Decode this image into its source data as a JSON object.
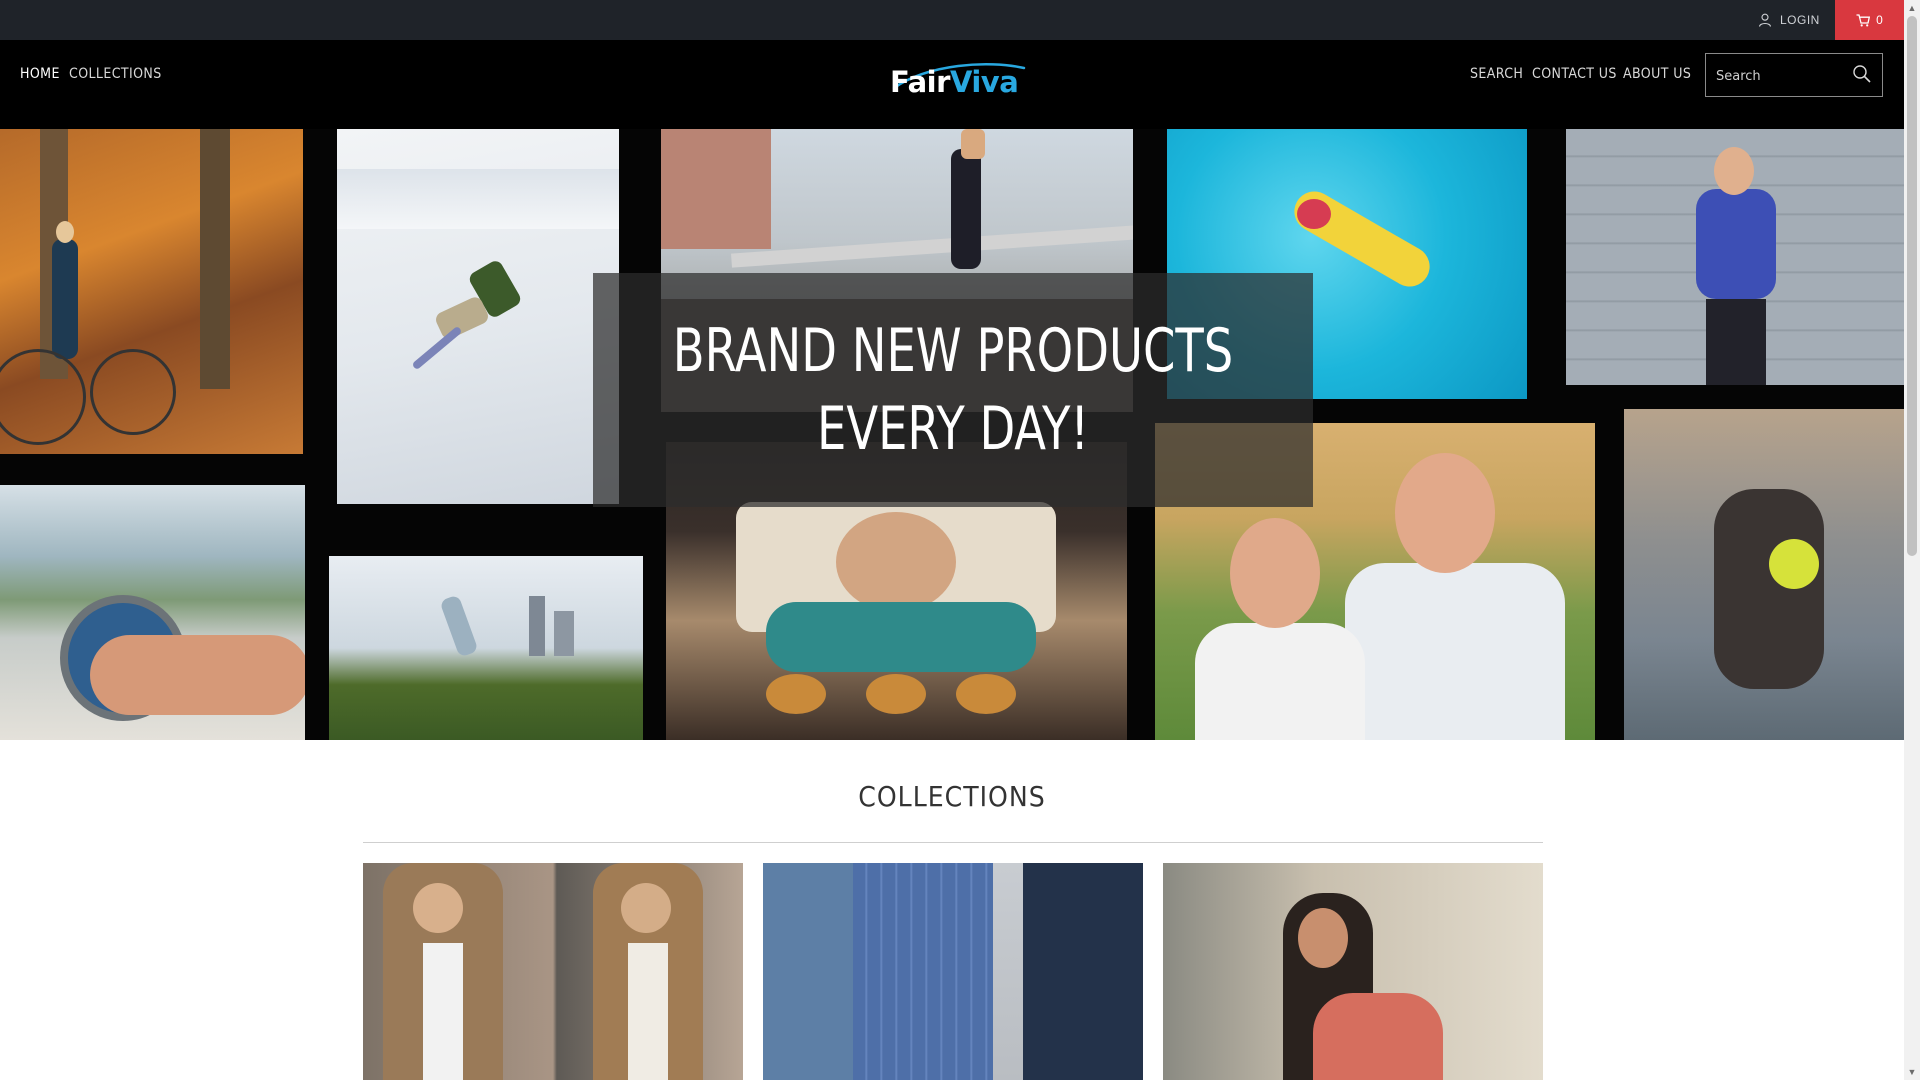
{
  "topbar": {
    "login_label": "LOGIN",
    "cart_count": "0",
    "user_icon": "user-icon",
    "cart_icon": "cart-icon",
    "cart_color": "#d9383f"
  },
  "nav": {
    "left": [
      {
        "label": "HOME",
        "active": true
      },
      {
        "label": "COLLECTIONS",
        "active": false
      }
    ],
    "right": [
      {
        "label": "SEARCH"
      },
      {
        "label": "CONTACT US"
      },
      {
        "label": "ABOUT US"
      }
    ],
    "logo": {
      "part1": "Fair",
      "part2": "Viva",
      "color1": "#ffffff",
      "color2": "#29a8e0"
    },
    "search": {
      "placeholder": "Search",
      "icon": "search-icon"
    }
  },
  "hero": {
    "title": "BRAND NEW PRODUCTS EVERY DAY!",
    "tiles": [
      {
        "name": "woman-with-bicycle-photo"
      },
      {
        "name": "snowboarder-photo"
      },
      {
        "name": "runner-on-bridge-photo"
      },
      {
        "name": "pool-float-photo"
      },
      {
        "name": "woman-in-purple-top-photo"
      },
      {
        "name": "fishing-reel-photo"
      },
      {
        "name": "acrobatic-yoga-photo"
      },
      {
        "name": "man-baking-muffins-photo"
      },
      {
        "name": "senior-couple-photo"
      },
      {
        "name": "dog-with-ball-photo"
      }
    ]
  },
  "collections": {
    "heading": "COLLECTIONS",
    "cards": [
      {
        "name": "mens-fashion-collection"
      },
      {
        "name": "suits-collection"
      },
      {
        "name": "womens-fashion-collection"
      }
    ]
  },
  "colors": {
    "topbar_bg": "#1f2329",
    "nav_bg": "#000000",
    "accent": "#d9383f"
  }
}
